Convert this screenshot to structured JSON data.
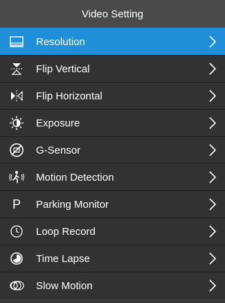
{
  "header": {
    "title": "Video Setting"
  },
  "colors": {
    "selected": "#1f8fd8",
    "row": "#323232",
    "header": "#4a4a4a"
  },
  "items": [
    {
      "label": "Resolution",
      "icon": "resolution-icon",
      "selected": true
    },
    {
      "label": "Flip Vertical",
      "icon": "flip-vertical-icon"
    },
    {
      "label": "Flip Horizontal",
      "icon": "flip-horizontal-icon"
    },
    {
      "label": "Exposure",
      "icon": "exposure-icon"
    },
    {
      "label": "G-Sensor",
      "icon": "g-sensor-icon"
    },
    {
      "label": "Motion Detection",
      "icon": "motion-detection-icon"
    },
    {
      "label": "Parking Monitor",
      "icon": "parking-monitor-icon",
      "icon_text": "P"
    },
    {
      "label": "Loop Record",
      "icon": "loop-record-icon"
    },
    {
      "label": "Time Lapse",
      "icon": "time-lapse-icon"
    },
    {
      "label": "Slow Motion",
      "icon": "slow-motion-icon"
    }
  ]
}
